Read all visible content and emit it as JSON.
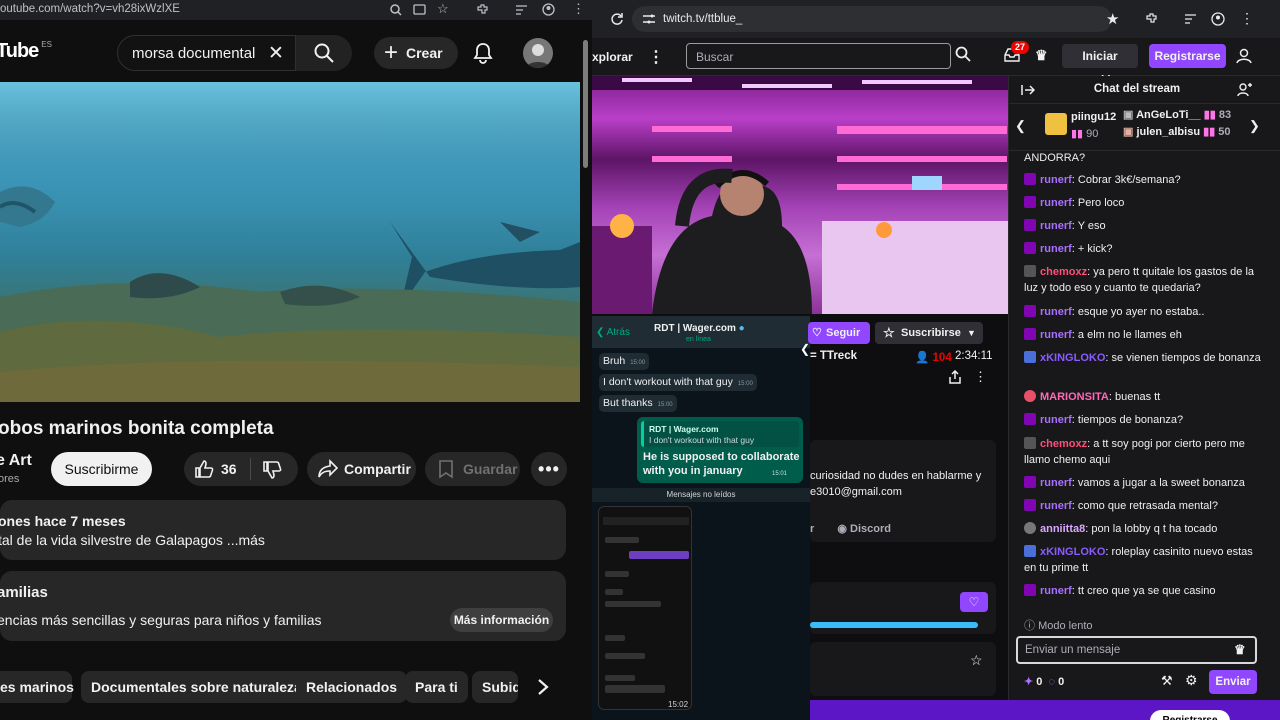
{
  "youtube": {
    "url": "outube.com/watch?v=vh28ixWzlXE",
    "logo": "Tube",
    "logo_region": "ES",
    "search_value": "morsa documental",
    "create_label": "Crear",
    "video_title": "obos marinos bonita completa",
    "channel_name": "e Art",
    "channel_subs": "ores",
    "subscribe_label": "Suscribirme",
    "like_count": "36",
    "share_label": "Compartir",
    "save_label": "Guardar",
    "description_meta": "ones  hace 7 meses",
    "description_text": "tal de la vida silvestre de Galapagos ...más",
    "family_title": "amilias",
    "family_text": "encias más sencillas y seguras para niños y familias",
    "family_button": "Más información",
    "chips": [
      "es marinos",
      "Documentales sobre naturaleza",
      "Relacionados",
      "Para ti",
      "Subid"
    ]
  },
  "twitch": {
    "url": "twitch.tv/ttblue_",
    "explore": "xplorar",
    "search_placeholder": "Buscar",
    "notif_count": "27",
    "login_label": "Iniciar sesión",
    "register_label": "Registrarse",
    "follow_label": "Seguir",
    "subscribe_label": "Suscribirse",
    "streamer": "= TTreck",
    "viewers": "104",
    "uptime": "2:34:11",
    "about_text_1": "curiosidad no dudes en hablarme y",
    "about_text_2": "e3010@gmail.com",
    "link_r": "r",
    "link_discord": "Discord",
    "footer_button": "Registrarse"
  },
  "whatsapp": {
    "back": "Atrás",
    "contact": "RDT | Wager.com",
    "status": "en línea",
    "messages": [
      {
        "text": "Bruh",
        "time": "15:00"
      },
      {
        "text": "I don't workout with that guy",
        "time": "15:00"
      },
      {
        "text": "But thanks",
        "time": "15:00"
      }
    ],
    "quote_name": "RDT | Wager.com",
    "quote_text": "I don't workout with that guy",
    "reply": "He is supposed to collaborate with you in january",
    "reply_time": "15:01",
    "unread": "Mensajes no leídos",
    "image_time": "15:02"
  },
  "chat": {
    "title": "Chat del stream",
    "gifters": [
      {
        "name": "piingu12",
        "count": "90"
      },
      {
        "name": "AnGeLoTi__",
        "count": "83"
      },
      {
        "name": "julen_albisu",
        "count": "50"
      }
    ],
    "messages": [
      {
        "user": "",
        "text": "ANDORRA?"
      },
      {
        "user": "runerf",
        "text": "Cobrar 3k€/semana?"
      },
      {
        "user": "runerf",
        "text": "Pero loco"
      },
      {
        "user": "runerf",
        "text": "Y eso"
      },
      {
        "user": "runerf",
        "text": "+ kick?"
      },
      {
        "user": "chemoxz",
        "text": "ya pero tt quitale los gastos de la luz y todo eso y cuanto te quedaria?"
      },
      {
        "user": "runerf",
        "text": "esque yo ayer no estaba.."
      },
      {
        "user": "runerf",
        "text": "a elm no le llames eh"
      },
      {
        "user": "xKINGLOKO",
        "text": "se vienen tiempos de bonanza"
      },
      {
        "user": "MARIONSITA",
        "text": "buenas tt"
      },
      {
        "user": "runerf",
        "text": "tiempos de bonanza?"
      },
      {
        "user": "chemoxz",
        "text": "a tt soy pogi por cierto pero me llamo chemo aqui"
      },
      {
        "user": "runerf",
        "text": "vamos a jugar a la sweet bonanza"
      },
      {
        "user": "runerf",
        "text": "como que retrasada mental?"
      },
      {
        "user": "anniitta8",
        "text": "pon la lobby q t ha tocado"
      },
      {
        "user": "xKINGLOKO",
        "text": "roleplay casinito nuevo estas en tu prime tt"
      },
      {
        "user": "runerf",
        "text": "tt creo que ya se que casino"
      }
    ],
    "mode": "Modo lento",
    "input_placeholder": "Enviar un mensaje",
    "points_1": "0",
    "points_2": "0",
    "send_label": "Enviar"
  },
  "colors": {
    "twitch_purple": "#9147ff",
    "youtube_bg": "#0f0f0f",
    "twitch_bg": "#0e0e10"
  }
}
